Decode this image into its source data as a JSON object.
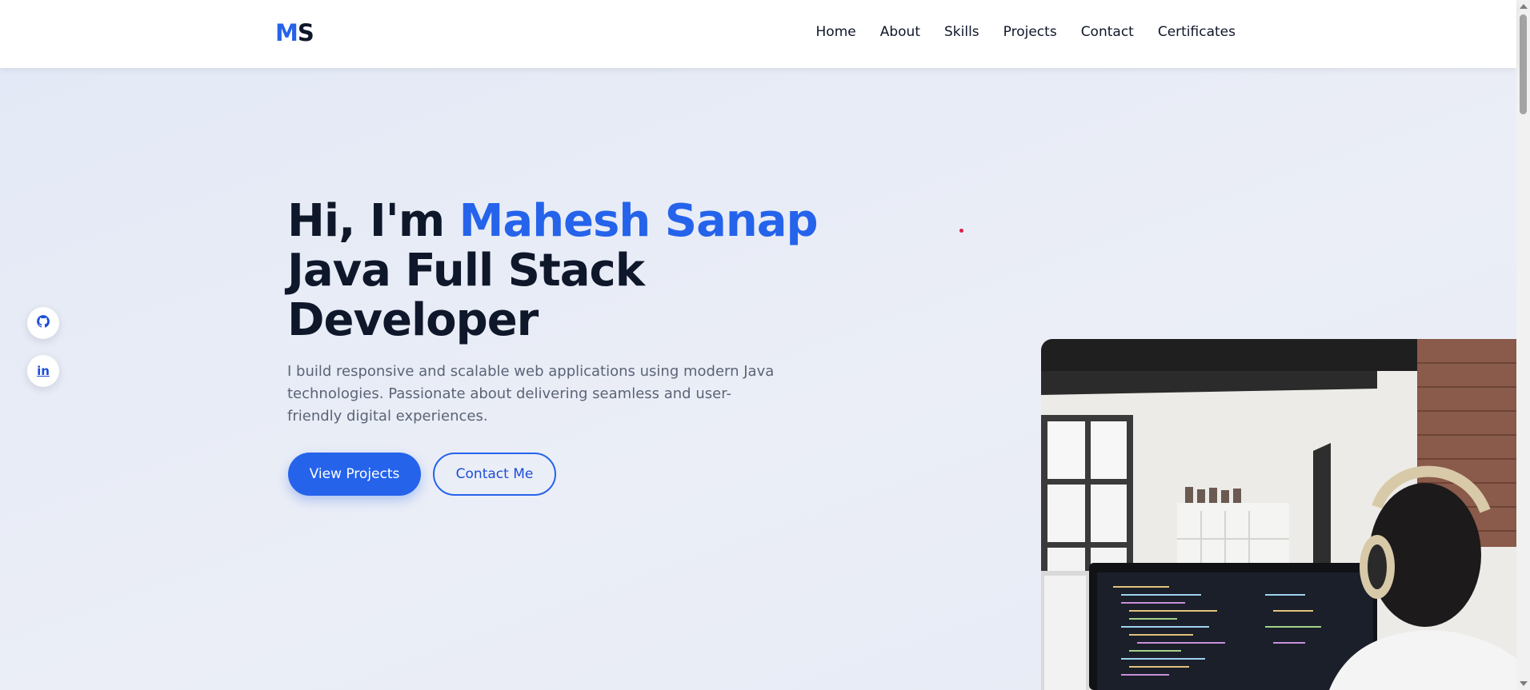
{
  "logo": {
    "first": "M",
    "second": "S"
  },
  "nav": {
    "items": [
      "Home",
      "About",
      "Skills",
      "Projects",
      "Contact",
      "Certificates"
    ]
  },
  "social": [
    {
      "icon": "github-icon"
    },
    {
      "icon": "linkedin-icon",
      "label": "in"
    }
  ],
  "hero": {
    "greeting": "Hi, I'm ",
    "name": "Mahesh Sanap",
    "role_line1": "Java Full Stack",
    "role_line2": "Developer",
    "description": "I build responsive and scalable web applications using modern Java technologies. Passionate about delivering seamless and user-friendly digital experiences.",
    "primary_button": "View Projects",
    "secondary_button": "Contact Me",
    "image": "developer-at-desk-with-headphones"
  },
  "colors": {
    "accent": "#2563eb",
    "heading": "#0f172a",
    "body_text": "#5b6477",
    "background": "#e9edf6"
  }
}
